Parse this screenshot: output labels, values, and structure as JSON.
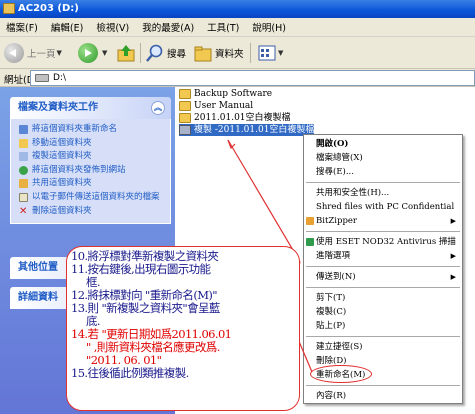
{
  "window": {
    "title": "AC203 (D:)"
  },
  "menu": [
    "檔案(F)",
    "編輯(E)",
    "檢視(V)",
    "我的最愛(A)",
    "工具(T)",
    "說明(H)"
  ],
  "toolbar": {
    "back": "上一頁",
    "search": "搜尋",
    "folders": "資料夾"
  },
  "address": {
    "label": "網址(D)",
    "value": "D:\\"
  },
  "left_pane": {
    "tasks_title": "檔案及資料夾工作",
    "tasks": [
      "將這個資料夾重新命名",
      "移動這個資料夾",
      "複製這個資料夾",
      "將這個資料夾發佈到網站",
      "共用這個資料夾",
      "以電子郵件傳送這個資料夾的檔案",
      "刪除這個資料夾"
    ],
    "other_places": "其他位置",
    "details": "詳細資料"
  },
  "files": [
    "Backup Software",
    "User Manual",
    "2011.01.01空白複製檔",
    "複製 -2011.01.01空白複製檔"
  ],
  "context_menu": {
    "items": [
      {
        "label": "開啟(O)",
        "bold": true
      },
      {
        "label": "檔案總管(X)"
      },
      {
        "label": "搜尋(E)..."
      },
      {
        "sep": true
      },
      {
        "label": "共用和安全性(H)..."
      },
      {
        "label": "Shred files with PC Confidential"
      },
      {
        "label": "BitZipper",
        "submenu": true
      },
      {
        "sep": true
      },
      {
        "label": "使用 ESET NOD32 Antivirus 掃描"
      },
      {
        "label": "進階選項",
        "submenu": true
      },
      {
        "sep": true
      },
      {
        "label": "傳送到(N)",
        "submenu": true
      },
      {
        "sep": true
      },
      {
        "label": "剪下(T)"
      },
      {
        "label": "複製(C)"
      },
      {
        "label": "貼上(P)"
      },
      {
        "sep": true
      },
      {
        "label": "建立捷徑(S)"
      },
      {
        "label": "刪除(D)"
      },
      {
        "label": "重新命名(M)"
      },
      {
        "sep": true
      },
      {
        "label": "內容(R)"
      }
    ]
  },
  "annotation": {
    "lines": [
      {
        "text": "10.將浮標對準新複製之資料夾",
        "color": "blk"
      },
      {
        "text": "11.按右鍵後,出現右圖示功能",
        "color": "blk"
      },
      {
        "text": "框.",
        "color": "blk",
        "indent": true
      },
      {
        "text": "12.將抹標對向 \"重新命名(M)\"",
        "color": "blk"
      },
      {
        "text": "13.則 \"新複製之資料夾\"會呈藍",
        "color": "blk"
      },
      {
        "text": "底.",
        "color": "blk",
        "indent": true
      },
      {
        "text": "14.若 \"更新日期如爲2011.06.01",
        "color": "red"
      },
      {
        "text": "\" ,則新資料夾檔名應更改爲.",
        "color": "red",
        "indent": true
      },
      {
        "text": "\"2011. 06. 01\"",
        "color": "red",
        "indent": true
      },
      {
        "text": "15.往後循此例類推複製.",
        "color": "blk"
      }
    ]
  },
  "colors": {
    "accent": "#215dc6",
    "selection": "#316ac5",
    "annotation_red": "#e00000"
  }
}
